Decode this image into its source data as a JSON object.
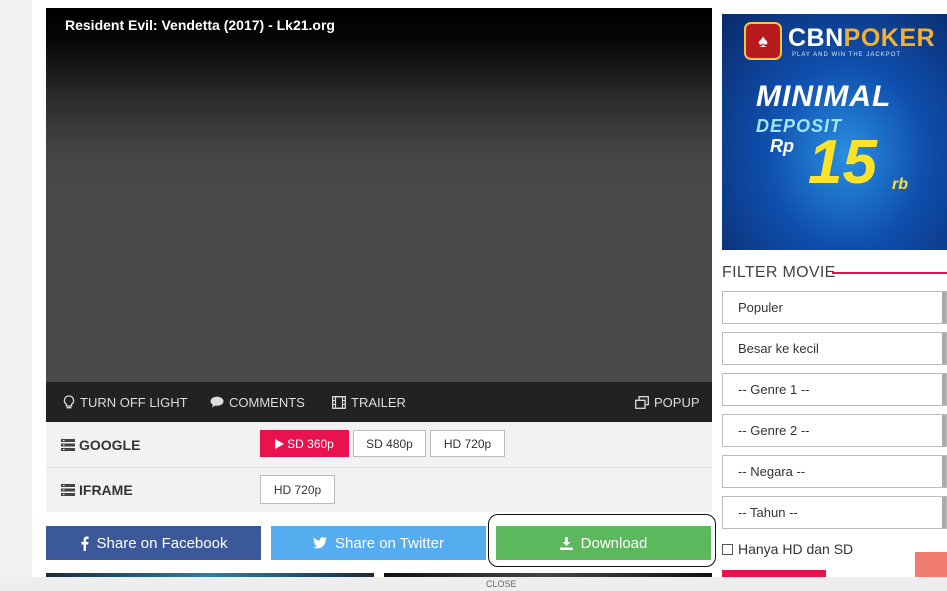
{
  "player": {
    "title": "Resident Evil: Vendetta (2017) - Lk21.org"
  },
  "controls": {
    "turn_off_light": "TURN OFF LIGHT",
    "comments": "COMMENTS",
    "trailer": "TRAILER",
    "popup": "POPUP"
  },
  "servers": [
    {
      "label": "GOOGLE",
      "qualities": [
        {
          "label": "SD 360p",
          "active": true
        },
        {
          "label": "SD 480p"
        },
        {
          "label": "HD 720p"
        }
      ]
    },
    {
      "label": "IFRAME",
      "qualities": [
        {
          "label": "HD 720p"
        }
      ]
    }
  ],
  "share": {
    "facebook": "Share on Facebook",
    "twitter": "Share on Twitter",
    "download": "Download"
  },
  "ad": {
    "brand_part1": "CBN",
    "brand_part2": "POKER",
    "tagline": "PLAY AND WIN THE JACKPOT",
    "minimal": "MINIMAL",
    "deposit": "DEPOSIT",
    "currency": "Rp",
    "amount": "15",
    "unit": "rb"
  },
  "filter": {
    "title": "FILTER MOVIE",
    "selects": [
      "Populer",
      "Besar ke kecil",
      "-- Genre 1 --",
      "-- Genre 2 --",
      "-- Negara --",
      "-- Tahun --"
    ],
    "checkbox_label": "Hanya HD dan SD"
  },
  "close_label": "CLOSE",
  "colors": {
    "accent": "#e8134e",
    "facebook": "#3b5998",
    "twitter": "#55acee",
    "download": "#5cb85c",
    "controlbar": "#222222"
  }
}
